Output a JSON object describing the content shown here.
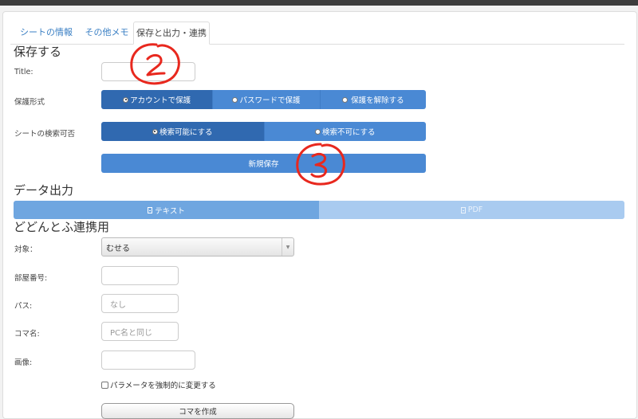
{
  "tabs": [
    "シートの情報",
    "その他メモ",
    "保存と出力・連携"
  ],
  "sections": {
    "save": "保存する",
    "export": "データ出力",
    "link": "どどんとふ連携用"
  },
  "save": {
    "title_label": "Title:",
    "title_value": "",
    "protect_label": "保護形式",
    "protect_options": [
      "アカウントで保護",
      "パスワードで保護",
      "保護を解除する"
    ],
    "search_label": "シートの検索可否",
    "search_options": [
      "検索可能にする",
      "検索不可にする"
    ],
    "save_button": "新規保存"
  },
  "export": {
    "text_button": "テキスト",
    "pdf_button": "PDF"
  },
  "link": {
    "target_label": "対象：",
    "target_value": "むせる",
    "room_label": "部屋番号:",
    "room_value": "",
    "pass_label": "パス:",
    "pass_placeholder": "なし",
    "koma_label": "コマ名:",
    "koma_placeholder": "PC名と同じ",
    "image_label": "画像:",
    "image_value": "",
    "force_param_label": "パラメータを強制的に変更する",
    "create_button": "コマを作成"
  },
  "colors": {
    "accent": "#4a89d4",
    "accent_selected": "#3069b0",
    "export_text_bg": "#6fa6e0",
    "export_pdf_bg": "#a9cbf0",
    "annotation": "#e8281e"
  },
  "icons": [
    "file-text-icon",
    "file-pdf-icon",
    "chevron-down-icon"
  ]
}
